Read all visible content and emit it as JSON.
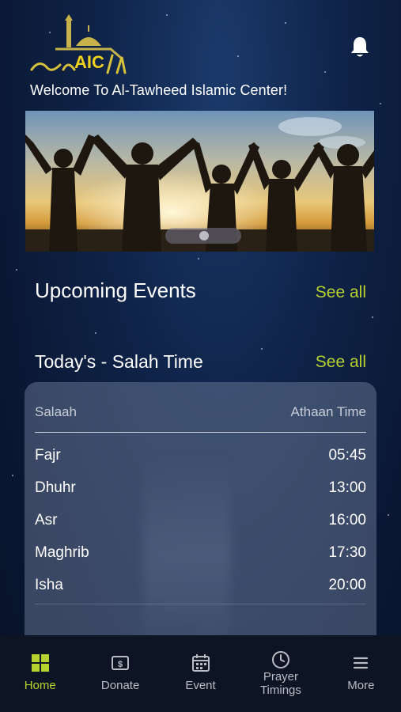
{
  "header": {
    "logo_text": "AIC",
    "welcome": "Welcome To Al-Tawheed Islamic Center!"
  },
  "banner": {
    "pages": 2,
    "active_page": 1
  },
  "events": {
    "title": "Upcoming Events",
    "see_all": "See all"
  },
  "salah": {
    "title": "Today's - Salah Time",
    "see_all": "See all",
    "col_salaah": "Salaah",
    "col_athaan": "Athaan Time",
    "rows": [
      {
        "name": "Fajr",
        "time": "05:45"
      },
      {
        "name": "Dhuhr",
        "time": "13:00"
      },
      {
        "name": "Asr",
        "time": "16:00"
      },
      {
        "name": "Maghrib",
        "time": "17:30"
      },
      {
        "name": "Isha",
        "time": "20:00"
      }
    ]
  },
  "nav": [
    {
      "label": "Home",
      "icon": "home-grid-icon",
      "active": true
    },
    {
      "label": "Donate",
      "icon": "donate-icon"
    },
    {
      "label": "Event",
      "icon": "calendar-icon"
    },
    {
      "label": "Prayer\nTimings",
      "icon": "clock-icon"
    },
    {
      "label": "More",
      "icon": "menu-icon"
    }
  ],
  "colors": {
    "accent": "#b7d22e",
    "background": "#0f2348",
    "nav_bg": "#0d1524"
  }
}
